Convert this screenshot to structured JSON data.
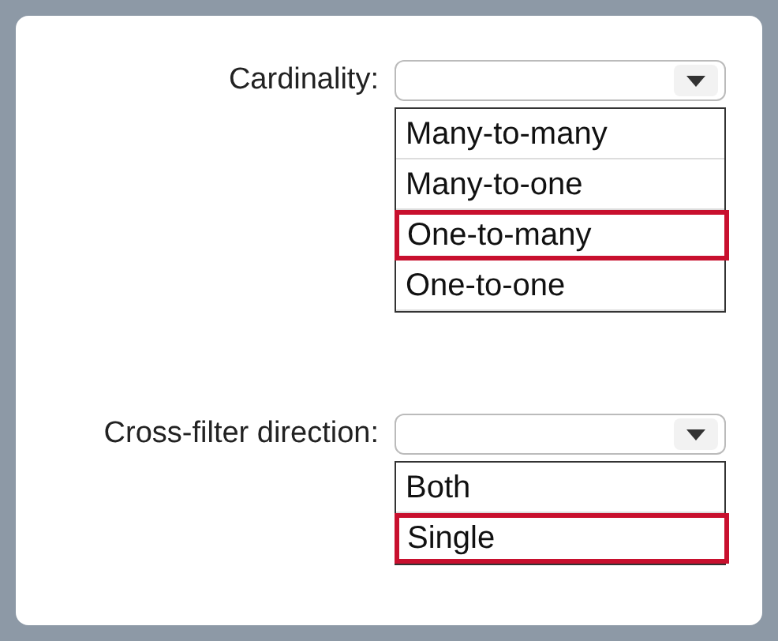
{
  "groups": [
    {
      "label": "Cardinality:",
      "options": [
        {
          "text": "Many-to-many",
          "selected": false
        },
        {
          "text": "Many-to-one",
          "selected": false
        },
        {
          "text": "One-to-many",
          "selected": true
        },
        {
          "text": "One-to-one",
          "selected": false
        }
      ]
    },
    {
      "label": "Cross-filter direction:",
      "options": [
        {
          "text": "Both",
          "selected": false
        },
        {
          "text": "Single",
          "selected": true
        }
      ]
    }
  ]
}
